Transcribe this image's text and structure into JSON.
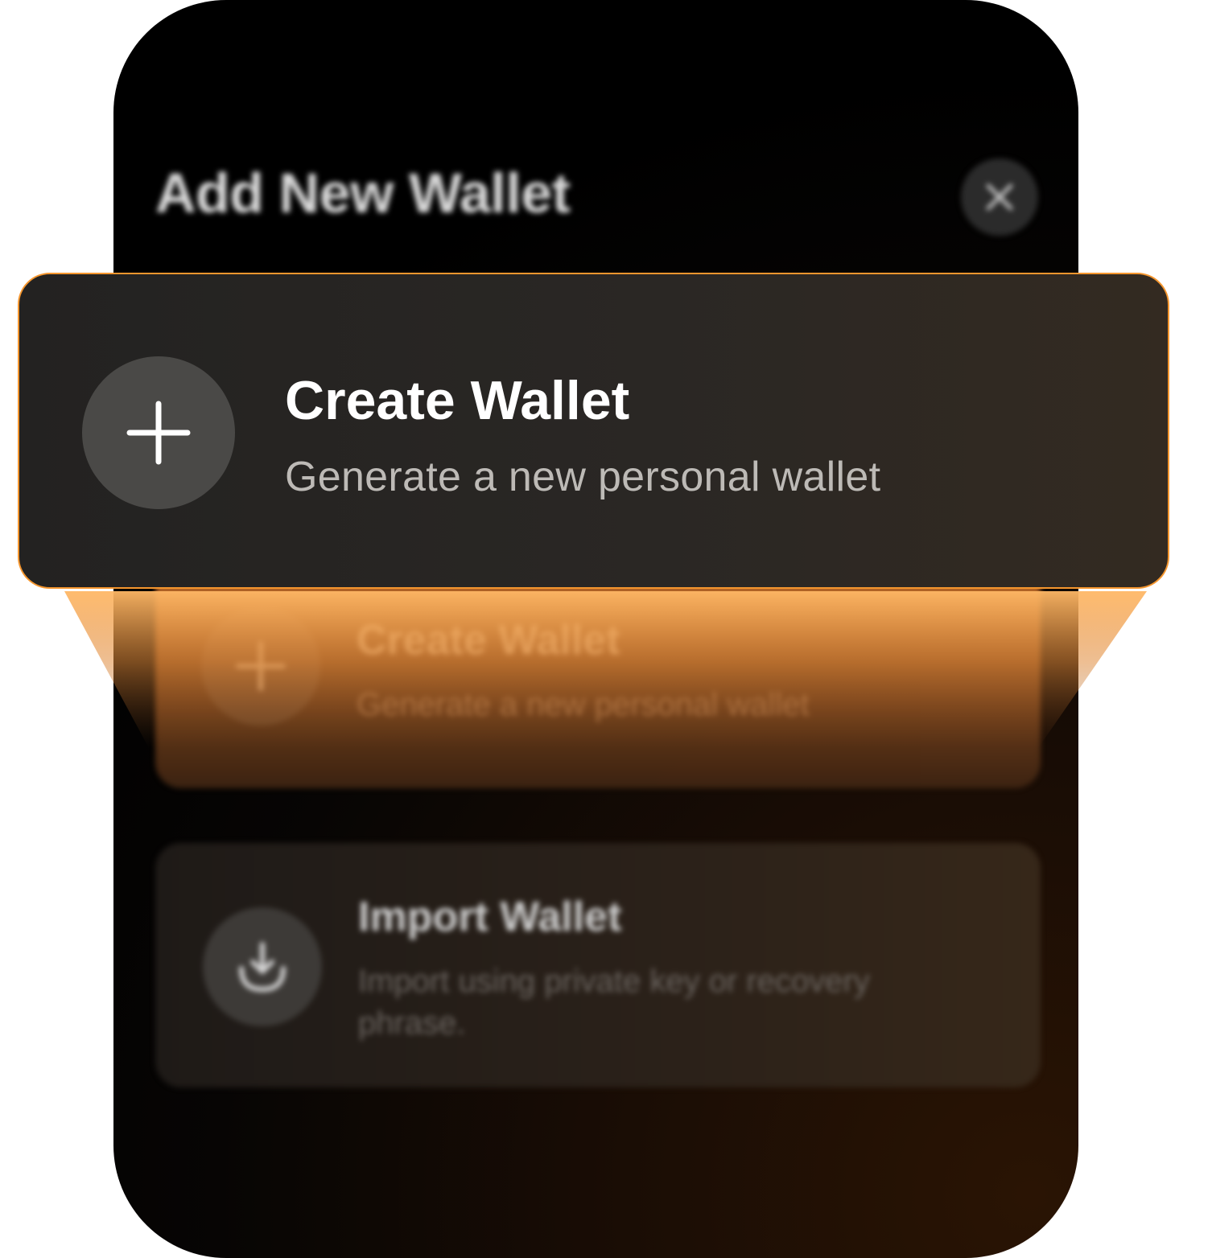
{
  "sheet": {
    "title": "Add New Wallet"
  },
  "options": [
    {
      "title": "Create Wallet",
      "description": "Generate a new personal wallet",
      "icon": "plus-icon"
    },
    {
      "title": "Import Wallet",
      "description": "Import using private key or recovery phrase.",
      "icon": "import-icon"
    }
  ],
  "focus": {
    "title": "Create Wallet",
    "description": "Generate a new personal wallet",
    "icon": "plus-icon"
  },
  "colors": {
    "accent": "#f5962e",
    "background": "#000000",
    "card": "#2a2724"
  }
}
